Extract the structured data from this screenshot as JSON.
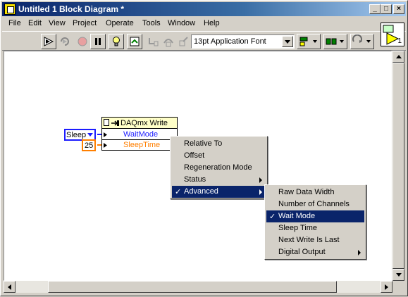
{
  "window": {
    "title": "Untitled 1 Block Diagram *",
    "controls": {
      "minimize": "_",
      "maximize": "□",
      "close": "×"
    }
  },
  "menubar": {
    "items": [
      {
        "label": "File"
      },
      {
        "label": "Edit"
      },
      {
        "label": "View"
      },
      {
        "label": "Project"
      },
      {
        "label": "Operate"
      },
      {
        "label": "Tools"
      },
      {
        "label": "Window"
      },
      {
        "label": "Help"
      }
    ]
  },
  "toolbar": {
    "font_select": "13pt Application Font",
    "icons": [
      "run-arrow-icon",
      "run-continuously-icon",
      "abort-icon",
      "pause-icon",
      "highlight-execution-icon",
      "retain-wire-values-icon",
      "step-into-icon",
      "step-over-icon",
      "step-out-icon",
      "align-icon",
      "distribute-icon",
      "reorder-icon"
    ]
  },
  "vi_icon": {
    "label": "1"
  },
  "diagram": {
    "node": {
      "title": "DAQmx Write",
      "rows": [
        "WaitMode",
        "SleepTime"
      ]
    },
    "sleep_control": {
      "value": "Sleep"
    },
    "number_constant": {
      "value": "25"
    },
    "colors": {
      "enum_blue": "#1c1cff",
      "number_orange": "#ff7f00"
    }
  },
  "context_menu": {
    "items": [
      {
        "label": "Relative To",
        "submenu": false,
        "checked": false
      },
      {
        "label": "Offset",
        "submenu": false,
        "checked": false
      },
      {
        "label": "Regeneration Mode",
        "submenu": false,
        "checked": false
      },
      {
        "label": "Status",
        "submenu": true,
        "checked": false
      },
      {
        "label": "Advanced",
        "submenu": true,
        "checked": true
      }
    ]
  },
  "submenu": {
    "items": [
      {
        "label": "Raw Data Width",
        "submenu": false,
        "checked": false
      },
      {
        "label": "Number of Channels",
        "submenu": false,
        "checked": false
      },
      {
        "label": "Wait Mode",
        "submenu": false,
        "checked": true
      },
      {
        "label": "Sleep Time",
        "submenu": false,
        "checked": false
      },
      {
        "label": "Next Write Is Last",
        "submenu": false,
        "checked": false
      },
      {
        "label": "Digital Output",
        "submenu": true,
        "checked": false
      }
    ]
  }
}
